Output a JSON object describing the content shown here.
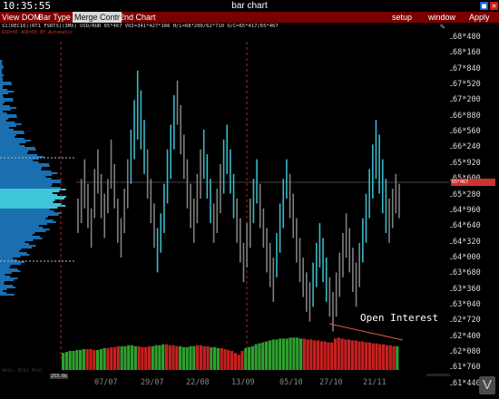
{
  "window": {
    "clock": "10:35:55",
    "title": "bar chart"
  },
  "menu": {
    "left_items": [
      "View DOM",
      "Bar Type",
      "Merge Contr",
      "2nd Chart"
    ],
    "active_item": "Merge Contr",
    "right_items": [
      "setup",
      "window",
      "Apply"
    ]
  },
  "info": {
    "line1": "S1(DEC16)(RT1 FSRTS)(3MX) USD/RUR 65*467 VOI=341*427*186 H/L=68*200/62*710 O/C=65*417/65*467",
    "line2": "RID=65 ASK=65 BY Automatic"
  },
  "y_axis": {
    "labels": [
      "68*480",
      "68*160",
      "67*840",
      "67*520",
      "67*200",
      "66*880",
      "66*560",
      "66*240",
      "65*920",
      "65*600",
      "65*280",
      "64*960",
      "64*640",
      "64*320",
      "64*000",
      "63*680",
      "63*360",
      "63*040",
      "62*720",
      "62*400",
      "62*080",
      "61*760",
      "61*440"
    ],
    "current_price_tag": "65*467"
  },
  "x_axis": {
    "labels": [
      "07/07",
      "29/07",
      "22/08",
      "13/09",
      "05/10",
      "27/10",
      "21/11"
    ]
  },
  "overlay": {
    "open_interest_label": "Open Interest",
    "oi_small": "253.6k",
    "volume_label": "Vols: 0(k) 0(k)"
  },
  "icons": [
    "edit-icon",
    "minimize-icon",
    "close-icon",
    "app-logo-icon"
  ],
  "colors": {
    "menubar": "#7a0000",
    "bar": "#7f7f7f",
    "bar_highlight": "#3ab8c8",
    "oi_up": "#2ea02e",
    "oi_down": "#c82020",
    "profile": "#1a6fb0"
  },
  "chart_data": {
    "type": "bar",
    "y_range": [
      61440,
      68480
    ],
    "bars": [
      [
        65200,
        64500
      ],
      [
        65600,
        64700
      ],
      [
        66000,
        65000
      ],
      [
        65500,
        64600
      ],
      [
        65000,
        64200
      ],
      [
        65800,
        64800
      ],
      [
        66200,
        65300
      ],
      [
        65700,
        64800
      ],
      [
        65300,
        64400
      ],
      [
        65600,
        64900
      ],
      [
        66400,
        65400
      ],
      [
        65900,
        65000
      ],
      [
        65200,
        64300
      ],
      [
        64800,
        64000
      ],
      [
        65400,
        64500
      ],
      [
        66000,
        65000
      ],
      [
        66600,
        65500
      ],
      [
        67200,
        66000
      ],
      [
        67800,
        66400
      ],
      [
        67400,
        66200
      ],
      [
        66800,
        65700
      ],
      [
        66200,
        65200
      ],
      [
        65600,
        64700
      ],
      [
        65100,
        64200
      ],
      [
        64600,
        63700
      ],
      [
        64900,
        64100
      ],
      [
        65500,
        64500
      ],
      [
        66200,
        65100
      ],
      [
        66700,
        65600
      ],
      [
        67300,
        66200
      ],
      [
        67600,
        66700
      ],
      [
        67100,
        66100
      ],
      [
        66500,
        65600
      ],
      [
        66000,
        65000
      ],
      [
        65500,
        64600
      ],
      [
        65200,
        64300
      ],
      [
        65700,
        64700
      ],
      [
        66200,
        65200
      ],
      [
        66600,
        65600
      ],
      [
        66100,
        65200
      ],
      [
        65600,
        64700
      ],
      [
        65100,
        64300
      ],
      [
        65400,
        64500
      ],
      [
        65900,
        64900
      ],
      [
        66400,
        65300
      ],
      [
        66700,
        65700
      ],
      [
        66200,
        65300
      ],
      [
        65700,
        64800
      ],
      [
        65200,
        64300
      ],
      [
        64800,
        63900
      ],
      [
        64300,
        63500
      ],
      [
        64700,
        63800
      ],
      [
        65200,
        64200
      ],
      [
        65600,
        64700
      ],
      [
        66000,
        65100
      ],
      [
        65500,
        64600
      ],
      [
        65000,
        64200
      ],
      [
        64600,
        63700
      ],
      [
        64300,
        63400
      ],
      [
        64000,
        63100
      ],
      [
        64500,
        63600
      ],
      [
        65100,
        64100
      ],
      [
        65600,
        64600
      ],
      [
        66000,
        65200
      ],
      [
        65700,
        64800
      ],
      [
        65300,
        64400
      ],
      [
        64800,
        63900
      ],
      [
        64400,
        63500
      ],
      [
        64000,
        63200
      ],
      [
        63700,
        62900
      ],
      [
        63500,
        62700
      ],
      [
        63900,
        63000
      ],
      [
        64300,
        63400
      ],
      [
        64700,
        63800
      ],
      [
        64400,
        63500
      ],
      [
        64000,
        63100
      ],
      [
        63600,
        62800
      ],
      [
        63300,
        62500
      ],
      [
        63700,
        62800
      ],
      [
        64100,
        63200
      ],
      [
        64500,
        63600
      ],
      [
        64900,
        64000
      ],
      [
        64600,
        63700
      ],
      [
        64200,
        63300
      ],
      [
        63900,
        63000
      ],
      [
        64300,
        63400
      ],
      [
        64800,
        63900
      ],
      [
        65300,
        64300
      ],
      [
        65800,
        64800
      ],
      [
        66300,
        65200
      ],
      [
        66800,
        65600
      ],
      [
        66500,
        65300
      ],
      [
        66000,
        64900
      ],
      [
        65600,
        64500
      ],
      [
        65200,
        64300
      ],
      [
        65400,
        64600
      ],
      [
        65700,
        64900
      ],
      [
        65500,
        64800
      ]
    ],
    "highlight_indices": [
      16,
      17,
      18,
      19,
      20,
      24,
      25,
      26,
      27,
      28,
      29,
      38,
      39,
      40,
      44,
      45,
      46,
      47,
      53,
      54,
      60,
      61,
      62,
      63,
      71,
      72,
      73,
      74,
      75,
      86,
      87,
      88,
      89,
      90,
      91,
      92,
      93
    ],
    "open_interest": [
      18,
      19,
      20,
      20,
      21,
      21,
      22,
      22,
      22,
      21,
      21,
      22,
      23,
      23,
      24,
      24,
      25,
      25,
      25,
      26,
      26,
      25,
      25,
      24,
      24,
      25,
      25,
      26,
      26,
      27,
      27,
      26,
      26,
      25,
      25,
      24,
      24,
      25,
      25,
      26,
      26,
      25,
      25,
      24,
      24,
      23,
      23,
      22,
      21,
      20,
      18,
      16,
      20,
      23,
      24,
      25,
      27,
      28,
      29,
      30,
      31,
      32,
      32,
      33,
      33,
      33,
      34,
      34,
      34,
      33,
      33,
      32,
      32,
      31,
      31,
      30,
      30,
      29,
      29,
      33,
      34,
      33,
      32,
      32,
      31,
      31,
      30,
      30,
      29,
      29,
      28,
      28,
      27,
      27,
      26,
      26,
      25,
      25
    ],
    "oi_colors": "gggggggrrrgggrrrrgggggrrrrggggrrrrgggggrrrrgggrrrrrrrgggggggggggggggggrrrrrrrrrrrrrrrrrrrrrrrrrrr"
  }
}
